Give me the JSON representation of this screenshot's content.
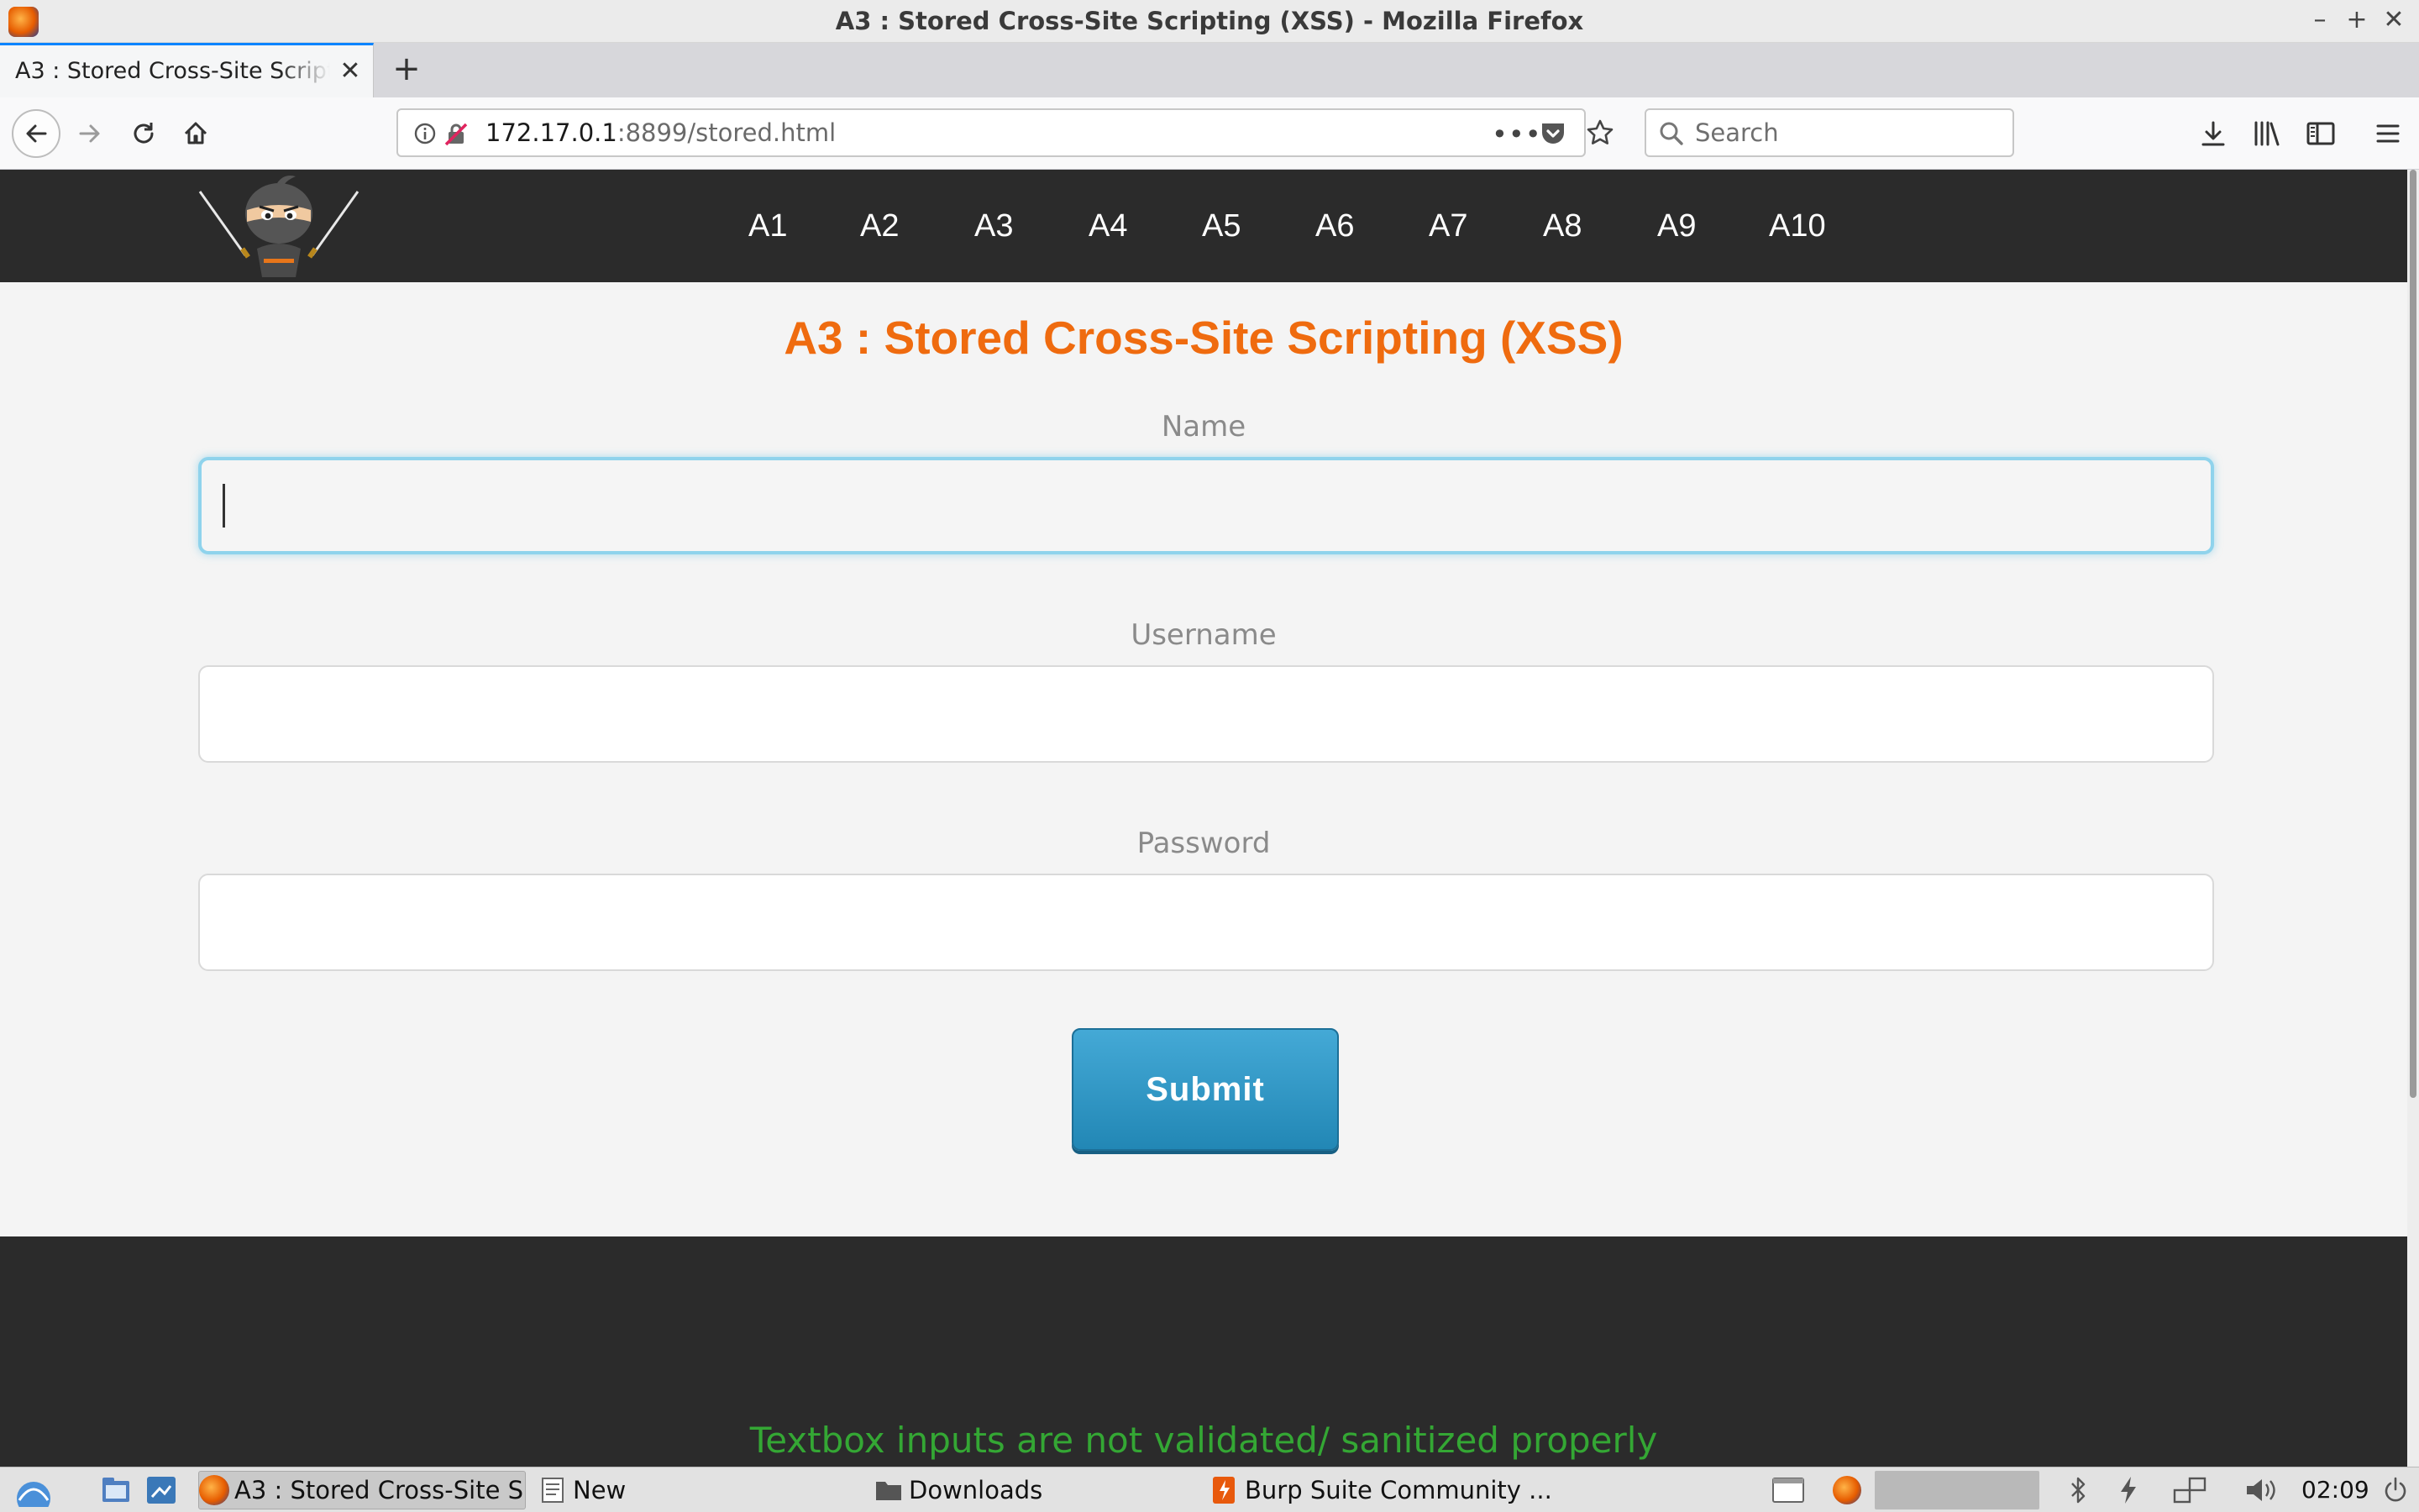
{
  "window": {
    "title": "A3 : Stored Cross-Site Scripting (XSS) - Mozilla Firefox"
  },
  "tabs": [
    {
      "label": "A3 : Stored Cross-Site Scripting (XSS)",
      "active": true
    }
  ],
  "navbar": {
    "url_host": "172.17.0.1",
    "url_rest": ":8899/stored.html",
    "search_placeholder": "Search"
  },
  "site": {
    "nav": [
      "A1",
      "A2",
      "A3",
      "A4",
      "A5",
      "A6",
      "A7",
      "A8",
      "A9",
      "A10"
    ],
    "title": "A3 : Stored Cross-Site Scripting (XSS)",
    "form": {
      "name_label": "Name",
      "name_value": "",
      "username_label": "Username",
      "username_value": "",
      "password_label": "Password",
      "password_value": "",
      "submit_label": "Submit"
    },
    "footer_note": "Textbox inputs are not validated/ sanitized properly"
  },
  "taskbar": {
    "items": [
      {
        "label": "A3 : Stored Cross-Site S...",
        "active": true,
        "icon": "firefox-icon"
      },
      {
        "label": "New",
        "active": false,
        "icon": "text-editor-icon"
      },
      {
        "label": "Downloads",
        "active": false,
        "icon": "folder-icon"
      },
      {
        "label": "Burp Suite Community ...",
        "active": false,
        "icon": "burp-icon"
      }
    ],
    "clock": "02:09"
  },
  "colors": {
    "title_orange": "#ef6b0f",
    "header_dark": "#2b2b2b",
    "submit_blue": "#2f99c7",
    "footer_green": "#34a734",
    "focus_ring": "#8fd3ec"
  }
}
